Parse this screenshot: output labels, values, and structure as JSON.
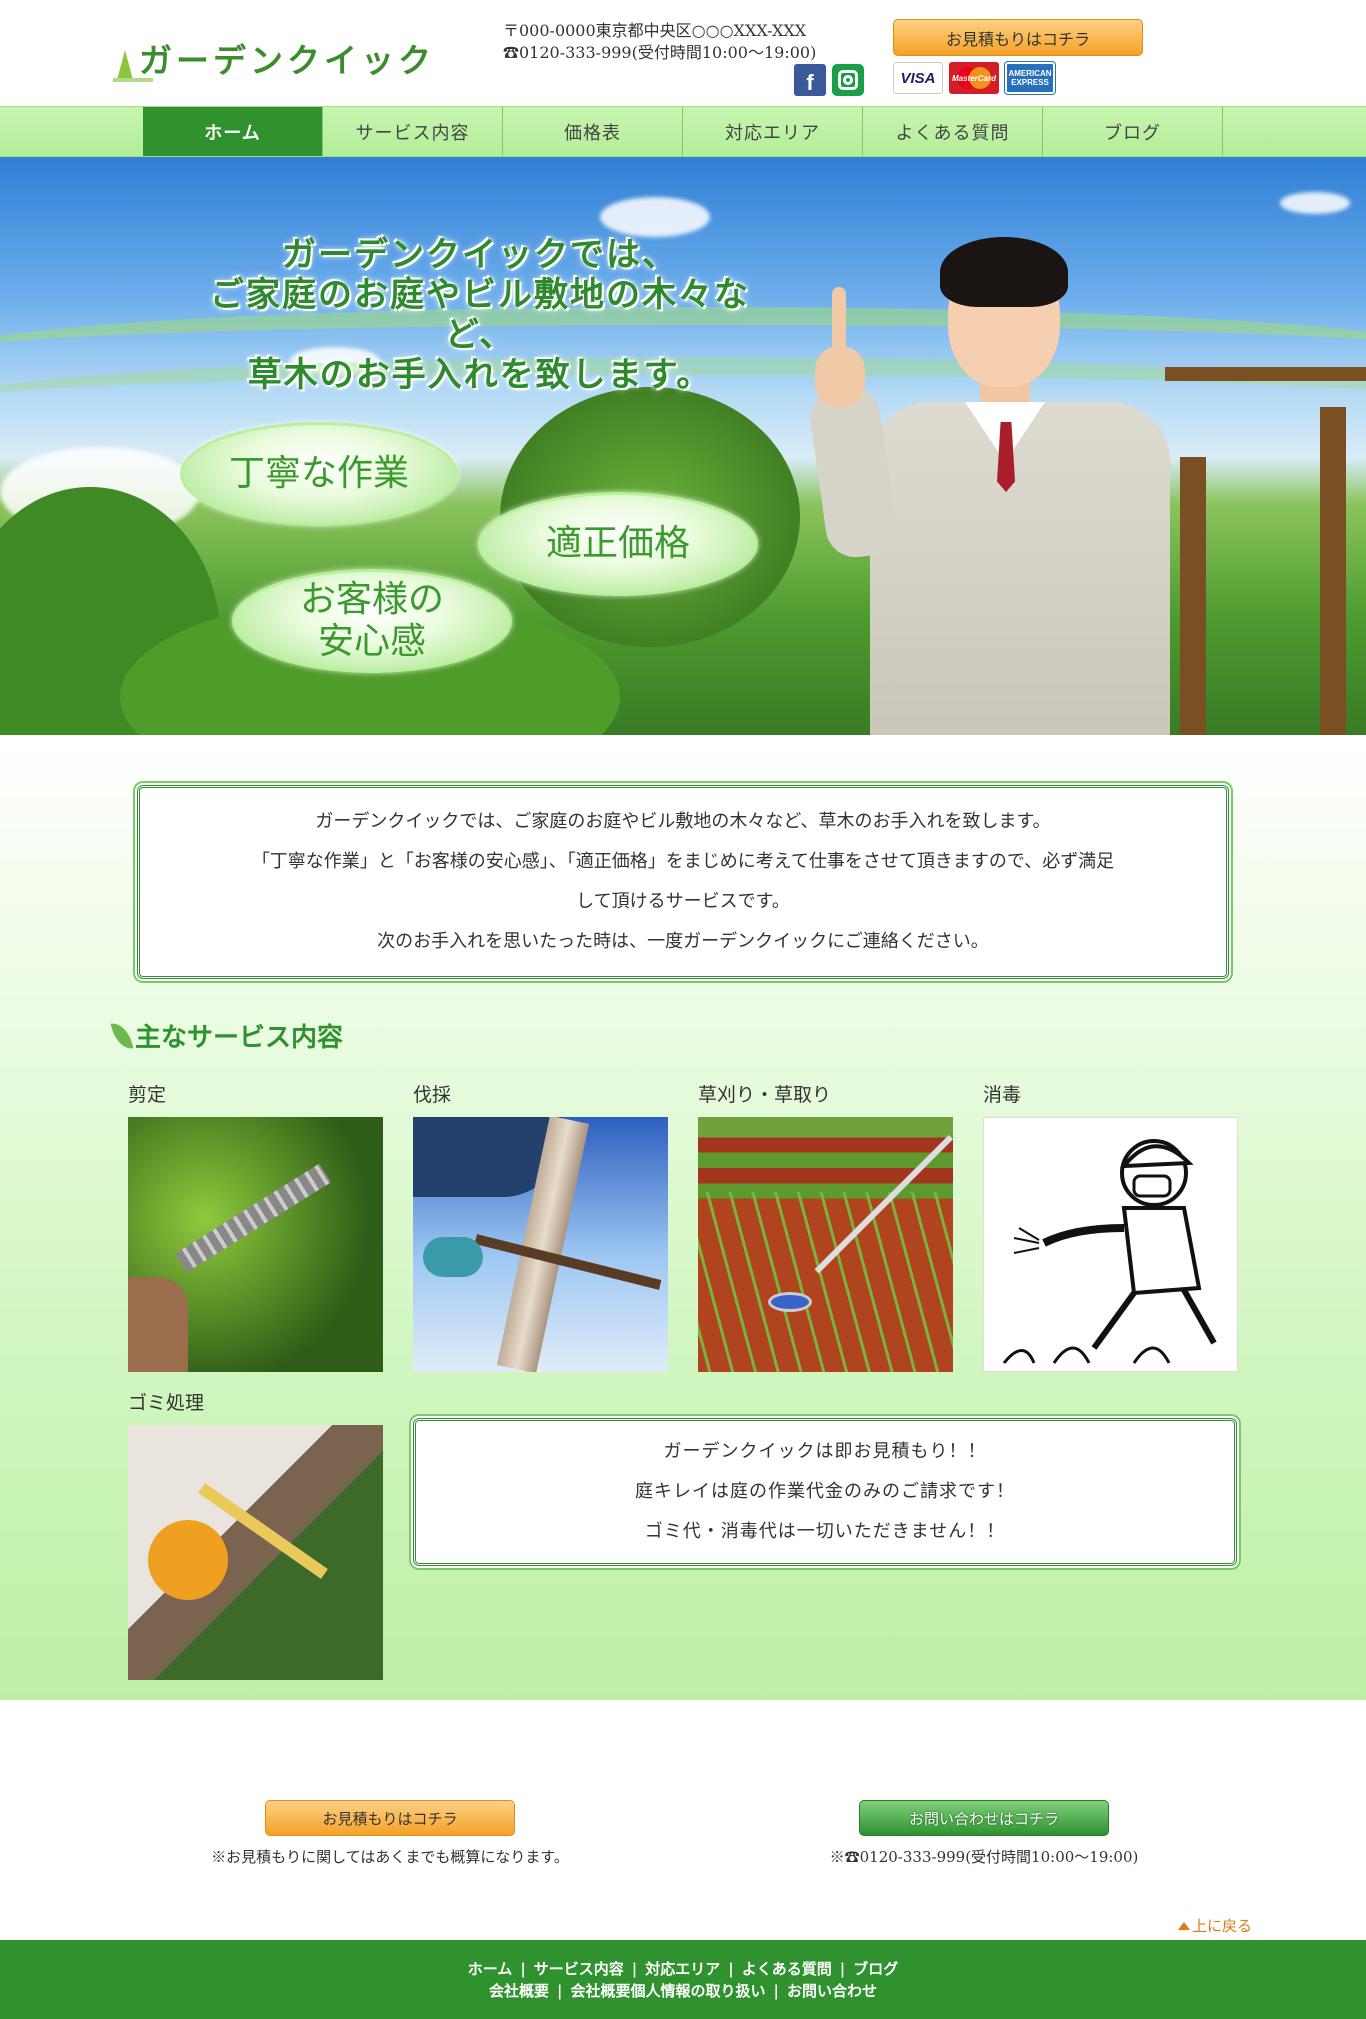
{
  "header": {
    "logo_text": "ガーデンクイック",
    "address": "〒000-0000東京都中央区○○○XXX-XXX",
    "phone": "☎0120-333-999(受付時間10:00〜19:00)",
    "estimate_button": "お見積もりはコチラ",
    "sns": {
      "facebook_icon": "facebook-icon",
      "facebook_glyph": "f",
      "instagram_icon": "instagram-icon"
    },
    "payment": {
      "visa": "VISA",
      "mastercard": "MasterCard",
      "amex": "AMERICAN EXPRESS"
    }
  },
  "nav": {
    "items": [
      {
        "label": "ホーム",
        "active": true
      },
      {
        "label": "サービス内容"
      },
      {
        "label": "価格表"
      },
      {
        "label": "対応エリア"
      },
      {
        "label": "よくある質問"
      },
      {
        "label": "ブログ"
      }
    ]
  },
  "hero": {
    "headline_1": "ガーデンクイックでは、",
    "headline_2": "ご家庭のお庭やビル敷地の木々など、",
    "headline_3": "草木のお手入れを致します。",
    "bubble_1": "丁寧な作業",
    "bubble_2": "適正価格",
    "bubble_3_line1": "お客様の",
    "bubble_3_line2": "安心感"
  },
  "intro": {
    "line_1": "ガーデンクイックでは、ご家庭のお庭やビル敷地の木々など、草木のお手入れを致します。",
    "line_2": "「丁寧な作業」と「お客様の安心感」、「適正価格」をまじめに考えて仕事をさせて頂きますので、必ず満足",
    "line_3": "して頂けるサービスです。",
    "line_4": "次のお手入れを思いたった時は、一度ガーデンクイックにご連絡ください。"
  },
  "services": {
    "title": "主なサービス内容",
    "items": [
      {
        "label": "剪定"
      },
      {
        "label": "伐採"
      },
      {
        "label": "草刈り・草取り"
      },
      {
        "label": "消毒"
      },
      {
        "label": "ゴミ処理"
      }
    ]
  },
  "info_box": {
    "line_1": "ガーデンクイックは即お見積もり！！",
    "line_2": "庭キレイは庭の作業代金のみのご請求です！",
    "line_3": "ゴミ代・消毒代は一切いただきません！！"
  },
  "cta": {
    "estimate_button": "お見積もりはコチラ",
    "estimate_note": "※お見積もりに関してはあくまでも概算になります。",
    "contact_button": "お問い合わせはコチラ",
    "contact_note": "※☎0120-333-999(受付時間10:00〜19:00)",
    "back_to_top": "上に戻る"
  },
  "footer": {
    "row_1": [
      "ホーム",
      "サービス内容",
      "対応エリア",
      "よくある質問",
      "ブログ"
    ],
    "row_2": [
      "会社概要",
      "会社概要個人情報の取り扱い",
      "お問い合わせ"
    ],
    "separator": "|"
  },
  "colors": {
    "brand_green": "#2f922f",
    "nav_green": "#b2ee98",
    "orange_button": "#f5a127"
  }
}
